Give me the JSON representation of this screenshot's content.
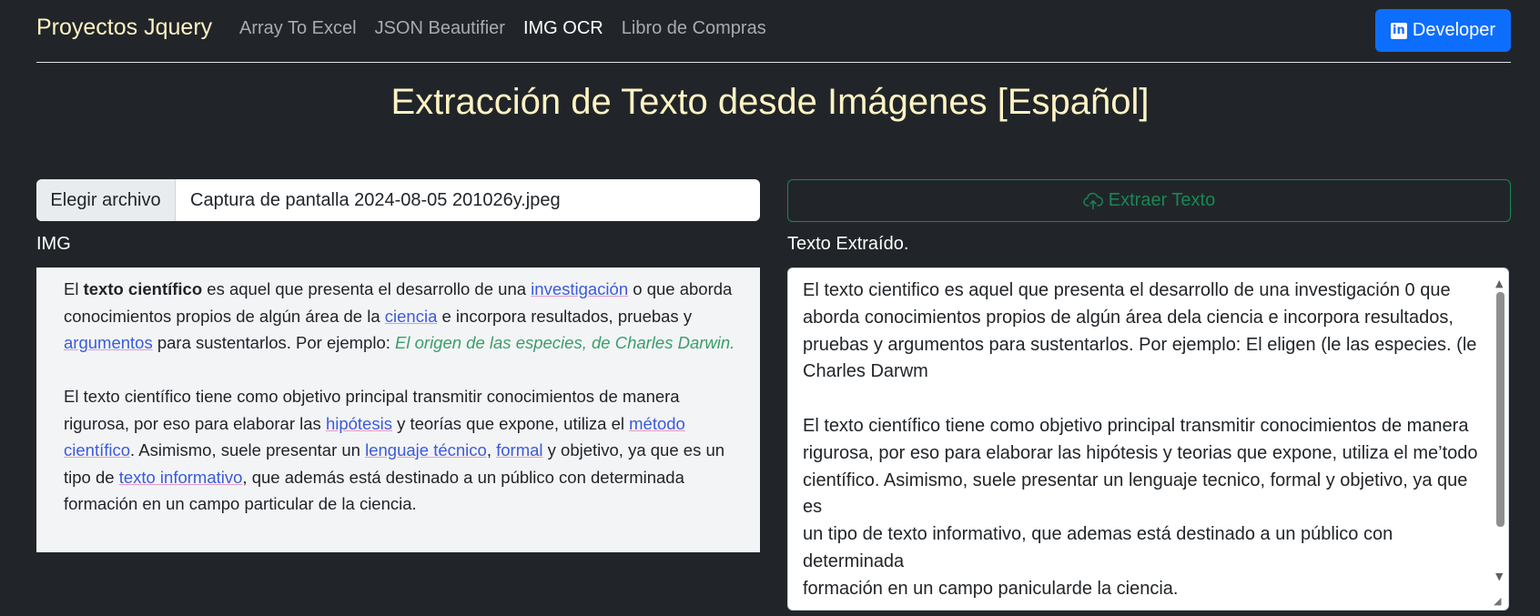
{
  "nav": {
    "brand": "Proyectos Jquery",
    "links": [
      "Array To Excel",
      "JSON Beautifier",
      "IMG OCR",
      "Libro de Compras"
    ],
    "active_link": "IMG OCR",
    "developer_button": "Developer"
  },
  "page": {
    "title": "Extracción de Texto desde Imágenes [Español]"
  },
  "file_input": {
    "button_label": "Elegir archivo",
    "file_name": "Captura de pantalla 2024-08-05 201026y.jpeg"
  },
  "extract_button": {
    "label": "Extraer Texto",
    "icon": "cloud-upload-icon"
  },
  "labels": {
    "img": "IMG",
    "extracted": "Texto Extraído."
  },
  "image_content": {
    "p1": {
      "t1": "El ",
      "bold": "texto científico",
      "t2": " es aquel que presenta el desarrollo de una ",
      "link1": "investigación",
      "t3": " o que aborda conocimientos propios de algún área de la ",
      "link2": "ciencia",
      "t4": " e incorpora resultados, pruebas y ",
      "link3": "argumentos",
      "t5": " para sustentarlos. Por ejemplo: ",
      "quote": "El origen de las especies, de Charles Darwin."
    },
    "p2": {
      "t1": "El texto científico tiene como objetivo principal transmitir conocimientos de manera rigurosa, por eso para elaborar las ",
      "link1": "hipótesis",
      "t2": " y teorías que expone, utiliza el ",
      "link2": "método científico",
      "t3": ". Asimismo, suele presentar un ",
      "link3": "lenguaje técnico",
      "t4": ", ",
      "link4": "formal",
      "t5": " y objetivo, ya que es un tipo de ",
      "link5": "texto informativo",
      "t6": ", que además está destinado a un público con determinada formación en un campo particular de la ciencia."
    }
  },
  "extracted_text": "El texto cientifico es aquel que presenta el desarrollo de una investigación 0 que\naborda conocimientos propios de algún área dela ciencia e incorpora resultados,\npruebas y argumentos para sustentarlos. Por ejemplo: El eligen (le las especies. (le\nCharles Darwm\n\nEl texto científico tiene como objetivo principal transmitir conocimientos de manera\nrigurosa, por eso para elaborar las hipótesis y teorias que expone, utiliza el me’todo\ncientífico. Asimismo, suele presentar un lenguaje tecnico, formal y objetivo, ya que\nes\nun tipo de texto informativo, que ademas está destinado a un público con\ndeterminada\nformación en un campo panicularde la ciencia.",
  "colors": {
    "background": "#212529",
    "brand": "#fff3c4",
    "primary": "#0d6efd",
    "success": "#198754"
  }
}
